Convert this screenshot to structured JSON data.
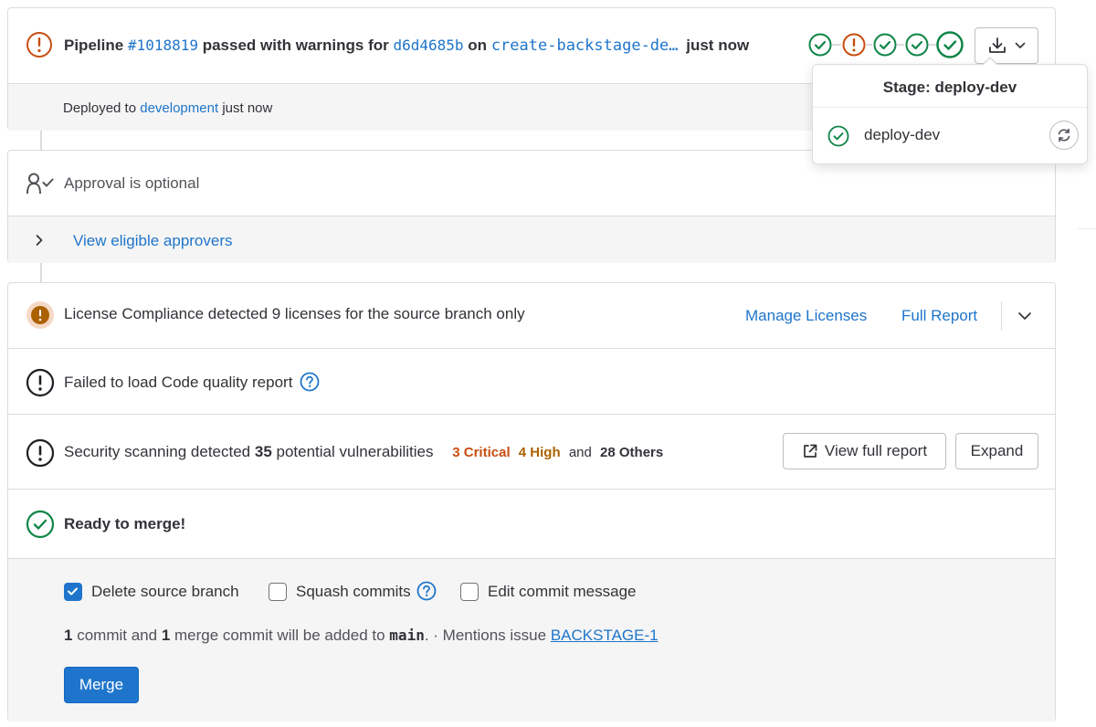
{
  "pipeline": {
    "label": "Pipeline",
    "id": "#1018819",
    "status_text": "passed with warnings for",
    "commit": "d6d4685b",
    "on": "on",
    "branch": "create-backstage-de…",
    "time": "just now",
    "deployed_prefix": "Deployed to",
    "environment": "development",
    "deployed_time": "just now"
  },
  "stage_popover": {
    "title": "Stage: deploy-dev",
    "job": "deploy-dev"
  },
  "approval": {
    "text": "Approval is optional",
    "view_approvers": "View eligible approvers"
  },
  "license": {
    "text": "License Compliance detected 9 licenses for the source branch only",
    "manage": "Manage Licenses",
    "full_report": "Full Report"
  },
  "code_quality": {
    "text": "Failed to load Code quality report"
  },
  "security": {
    "prefix": "Security scanning detected",
    "count": "35",
    "suffix": "potential vulnerabilities",
    "critical": "3 Critical",
    "high": "4 High",
    "and": "and",
    "others": "28 Others",
    "view_full": "View full report",
    "expand": "Expand"
  },
  "merge": {
    "ready": "Ready to merge!",
    "delete_branch": "Delete source branch",
    "squash": "Squash commits",
    "edit_message": "Edit commit message",
    "commit_count": "1",
    "commit_text": "commit and",
    "merge_count": "1",
    "merge_text": "merge commit will be added to",
    "target_branch": "main",
    "dot": ".",
    "mentions": "· Mentions issue",
    "issue": "BACKSTAGE-1",
    "button": "Merge"
  },
  "colors": {
    "success": "#108548",
    "warning": "#c17d10",
    "warning_dark": "#ab6100",
    "danger_orange": "#c74e10",
    "link": "#1f75cb",
    "primary": "#1f75cb"
  }
}
